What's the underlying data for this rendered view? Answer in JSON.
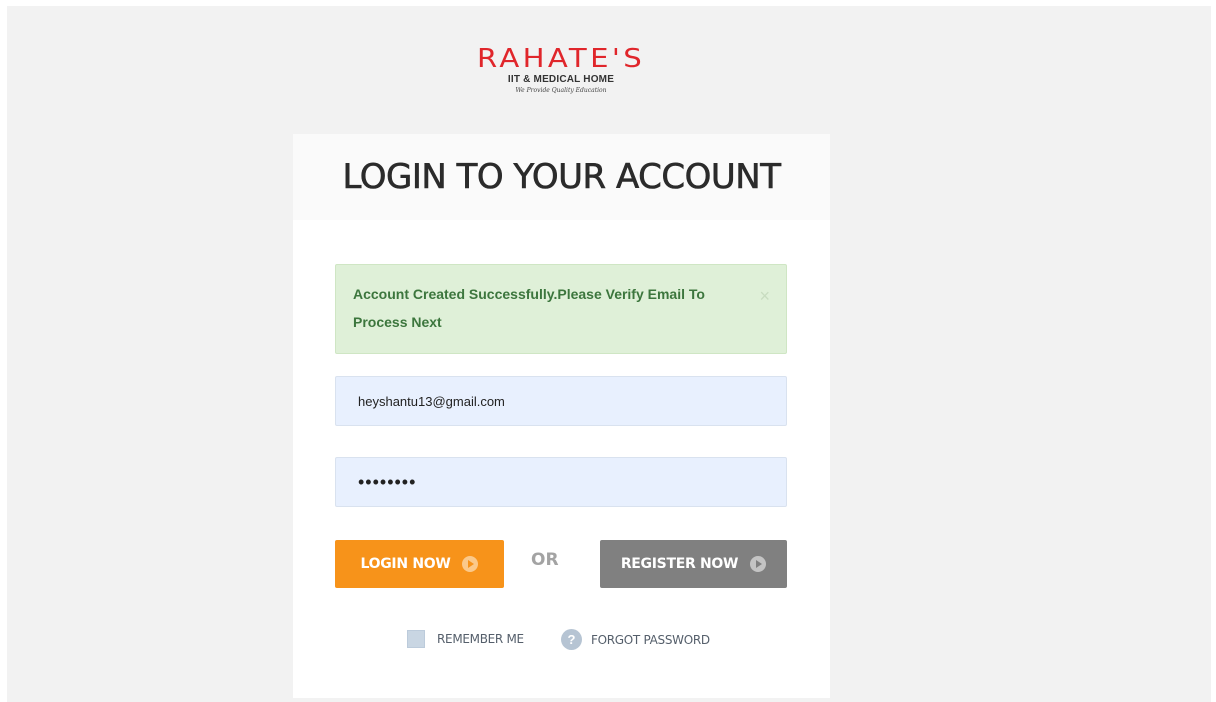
{
  "logo": {
    "name": "RAHATE'S",
    "subtitle": "IIT & MEDICAL HOME",
    "tagline": "We Provide Quality Education"
  },
  "login": {
    "title": "LOGIN TO YOUR ACCOUNT",
    "alert": {
      "message": "Account Created Successfully.Please Verify Email To Process Next",
      "close_symbol": "×"
    },
    "email_value": "heyshantu13@gmail.com",
    "password_value": "••••••••",
    "login_button": "LOGIN NOW",
    "or_text": "OR",
    "register_button": "REGISTER NOW",
    "remember_label": "REMEMBER ME",
    "forgot_label": "FORGOT PASSWORD",
    "help_symbol": "?"
  },
  "colors": {
    "brand_red": "#e0262b",
    "login_orange": "#f7931a",
    "register_gray": "#808080",
    "alert_green_bg": "#dff0d8",
    "alert_green_text": "#3c763d",
    "input_bg": "#e8f0fe"
  },
  "icons": {
    "login_button_icon": "arrow-circle-right-icon",
    "register_button_icon": "arrow-circle-right-icon",
    "forgot_icon": "question-circle-icon",
    "alert_close_icon": "close-icon"
  }
}
